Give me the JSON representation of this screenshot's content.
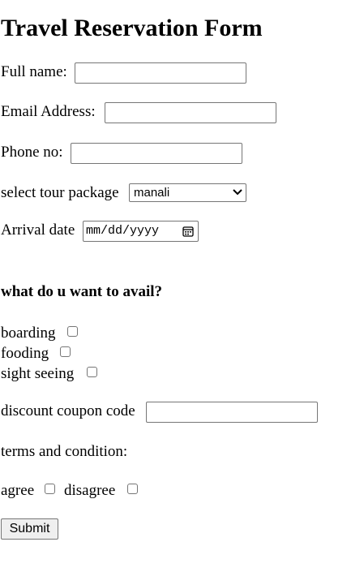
{
  "form": {
    "title": "Travel Reservation Form",
    "full_name": {
      "label": "Full name:",
      "value": ""
    },
    "email": {
      "label": "Email Address:",
      "value": ""
    },
    "phone": {
      "label": "Phone no:",
      "value": ""
    },
    "tour_package": {
      "label": "select tour package",
      "selected": "manali"
    },
    "arrival_date": {
      "label": "Arrival date",
      "placeholder": "mm/dd/yyyy"
    },
    "avail_heading": "what do u want to avail?",
    "avail_options": [
      {
        "label": "boarding",
        "checked": false
      },
      {
        "label": "fooding",
        "checked": false
      },
      {
        "label": "sight seeing",
        "checked": false
      }
    ],
    "coupon": {
      "label": "discount coupon code",
      "value": ""
    },
    "terms_label": "terms and condition:",
    "terms_options": [
      {
        "label": "agree",
        "checked": false
      },
      {
        "label": "disagree",
        "checked": false
      }
    ],
    "submit_label": "Submit"
  }
}
